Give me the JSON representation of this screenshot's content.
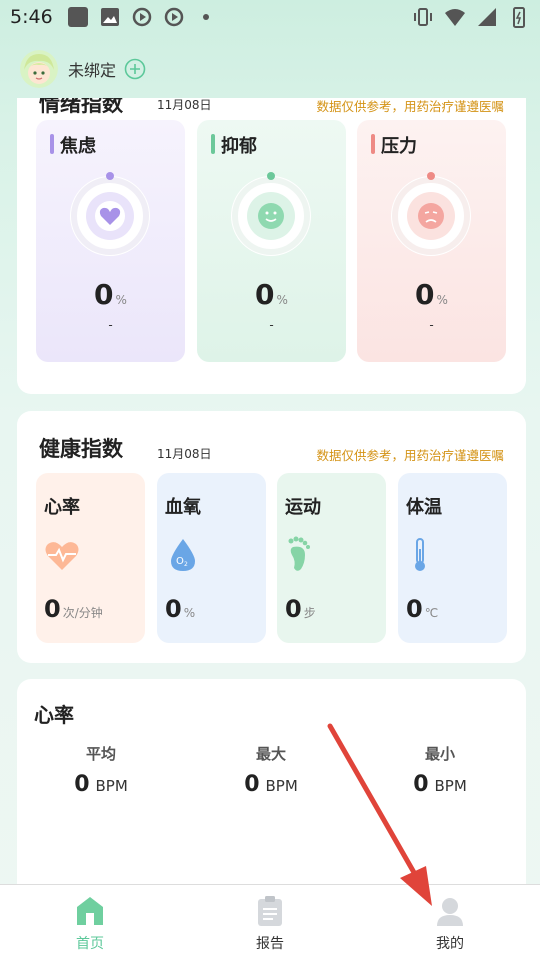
{
  "status_bar": {
    "time": "5:46"
  },
  "header": {
    "bind_status": "未绑定"
  },
  "emotion": {
    "title": "情绪指数",
    "date": "11月08日",
    "note": "数据仅供参考，用药治疗谨遵医嘱",
    "items": [
      {
        "label": "焦虑",
        "value": "0",
        "unit": "%",
        "sub": "-",
        "color": "#a892e8",
        "bg": "#ece7fb"
      },
      {
        "label": "抑郁",
        "value": "0",
        "unit": "%",
        "sub": "-",
        "color": "#6cc89a",
        "bg": "#e3f5eb"
      },
      {
        "label": "压力",
        "value": "0",
        "unit": "%",
        "sub": "-",
        "color": "#ee8a85",
        "bg": "#fde6e4"
      }
    ]
  },
  "health": {
    "title": "健康指数",
    "date": "11月08日",
    "note": "数据仅供参考，用药治疗谨遵医嘱",
    "items": [
      {
        "label": "心率",
        "value": "0",
        "unit": "次/分钟",
        "icon": "heart-rate-icon",
        "bg": "#fff1ea"
      },
      {
        "label": "血氧",
        "value": "0",
        "unit": "%",
        "icon": "oxygen-drop-icon",
        "bg": "#eaf2fc"
      },
      {
        "label": "运动",
        "value": "0",
        "unit": "步",
        "icon": "footprint-icon",
        "bg": "#e8f6ee"
      },
      {
        "label": "体温",
        "value": "0",
        "unit": "℃",
        "icon": "thermometer-icon",
        "bg": "#eaf2fc"
      }
    ]
  },
  "heart_rate": {
    "title": "心率",
    "stats": [
      {
        "label": "平均",
        "value": "0",
        "unit": "BPM"
      },
      {
        "label": "最大",
        "value": "0",
        "unit": "BPM"
      },
      {
        "label": "最小",
        "value": "0",
        "unit": "BPM"
      }
    ]
  },
  "nav": {
    "items": [
      {
        "label": "首页",
        "icon": "home-icon",
        "active": true
      },
      {
        "label": "报告",
        "icon": "report-icon",
        "active": false
      },
      {
        "label": "我的",
        "icon": "profile-icon",
        "active": false
      }
    ]
  },
  "colors": {
    "accent": "#5cc89a",
    "note": "#d49316",
    "arrow": "#e0443a"
  }
}
